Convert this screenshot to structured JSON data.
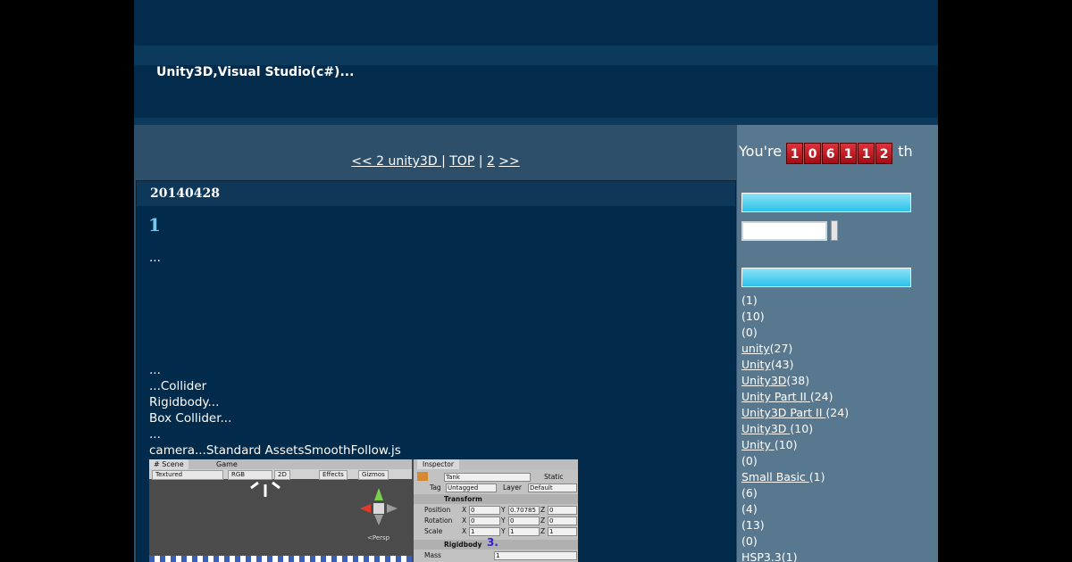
{
  "header": {
    "description": "Unity3D,Visual Studio(c#)..."
  },
  "nav": {
    "prev": "<< 2 unity3D ",
    "sep1": " | ",
    "top": "TOP",
    "sep2": " | ",
    "next_num": "2",
    "next_arrow": ">>"
  },
  "article": {
    "date": "20140428",
    "title": "1",
    "lines": [
      "...",
      "...",
      "...Collider",
      "Rigidbody...",
      "Box Collider...",
      "...",
      "camera...Standard AssetsSmoothFollow.js"
    ]
  },
  "screenshot": {
    "scene_tab": "# Scene",
    "game_tab": "Game",
    "textured": "Textured",
    "rgb": "RGB",
    "mode_2d": "2D",
    "effects": "Effects",
    "gizmos": "Gizmos",
    "persp": "<Persp",
    "inspector_tab": "Inspector",
    "object_name": "Tank",
    "static_label": "Static",
    "tag_label": "Tag",
    "tag_value": "Untagged",
    "layer_label": "Layer",
    "layer_value": "Default",
    "transform": "Transform",
    "position": "Position",
    "rotation": "Rotation",
    "scale": "Scale",
    "pos_x": "0",
    "pos_y": "0.70785",
    "pos_z": "0",
    "rot_x": "0",
    "rot_y": "0",
    "rot_z": "0",
    "scl_x": "1",
    "scl_y": "1",
    "scl_z": "1",
    "axis_x": "X",
    "axis_y": "Y",
    "axis_z": "Z",
    "rigidbody": "Rigidbody",
    "rigidbody_num": "3.",
    "mass_label": "Mass",
    "mass_value": "1"
  },
  "sidebar": {
    "counter_prefix": "You're",
    "counter_digits": [
      "1",
      "0",
      "6",
      "1",
      "1",
      "2"
    ],
    "counter_suffix": "th",
    "categories": [
      {
        "link": "",
        "count": "(1)"
      },
      {
        "link": "",
        "count": "(10)"
      },
      {
        "link": "",
        "count": "(0)"
      },
      {
        "link": "unity",
        "count": "(27)"
      },
      {
        "link": "Unity",
        "count": "(43)"
      },
      {
        "link": "Unity3D",
        "count": "(38)"
      },
      {
        "link": "Unity Part II ",
        "count": "(24)"
      },
      {
        "link": "Unity3D Part II ",
        "count": "(24)"
      },
      {
        "link": "Unity3D ",
        "count": "(10)"
      },
      {
        "link": "Unity ",
        "count": "(10)"
      },
      {
        "link": "",
        "count": "(0)"
      },
      {
        "link": "Small Basic ",
        "count": "(1)"
      },
      {
        "link": "",
        "count": "(6)"
      },
      {
        "link": "",
        "count": "(4)"
      },
      {
        "link": "",
        "count": "(13)"
      },
      {
        "link": "",
        "count": "(0)"
      },
      {
        "link": "HSP3.3",
        "count": "(1)"
      }
    ]
  },
  "colors": {
    "background": "#000000",
    "page": "#022a4a",
    "main_panel": "#2e4f6a",
    "sidebar": "#587890",
    "title_accent": "#7dc7ef",
    "sidebar_button": "#2ac1ea",
    "counter_digit": "#c8141d"
  }
}
